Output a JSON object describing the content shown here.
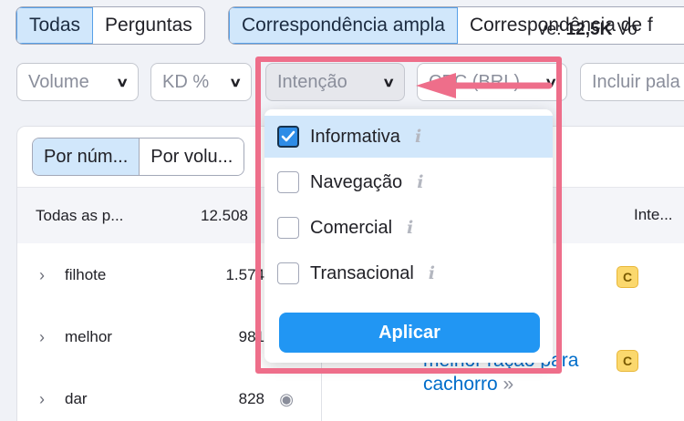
{
  "top_tabs_a": [
    "Todas",
    "Perguntas"
  ],
  "top_tabs_b": [
    "Correspondência ampla",
    "Correspondência de f"
  ],
  "filters": {
    "volume": "Volume",
    "kd": "KD %",
    "intent": "Intenção",
    "cpc": "CPC (BRL)",
    "include": "Incluir pala"
  },
  "mini_tabs": [
    "Por núm...",
    "Por volu..."
  ],
  "list_head": {
    "label": "Todas as p...",
    "count": "12.508"
  },
  "groups": [
    {
      "word": "filhote",
      "count": "1.574"
    },
    {
      "word": "melhor",
      "count": "981"
    },
    {
      "word": "dar",
      "count": "828"
    }
  ],
  "summary": {
    "prefix": "ve:",
    "value": "12,5K",
    "suffix": "Vo"
  },
  "column_intent": "Inte...",
  "badges": [
    "C",
    "C"
  ],
  "link": {
    "line1": "melhor ração para",
    "line2": "cachorro"
  },
  "dropdown": {
    "options": [
      {
        "label": "Informativa",
        "checked": true
      },
      {
        "label": "Navegação",
        "checked": false
      },
      {
        "label": "Comercial",
        "checked": false
      },
      {
        "label": "Transacional",
        "checked": false
      }
    ],
    "info_glyph": "i",
    "apply_label": "Aplicar"
  },
  "colors": {
    "highlight": "#ee6e8a",
    "accent": "#2196f3",
    "selected": "#d1e7fb"
  }
}
